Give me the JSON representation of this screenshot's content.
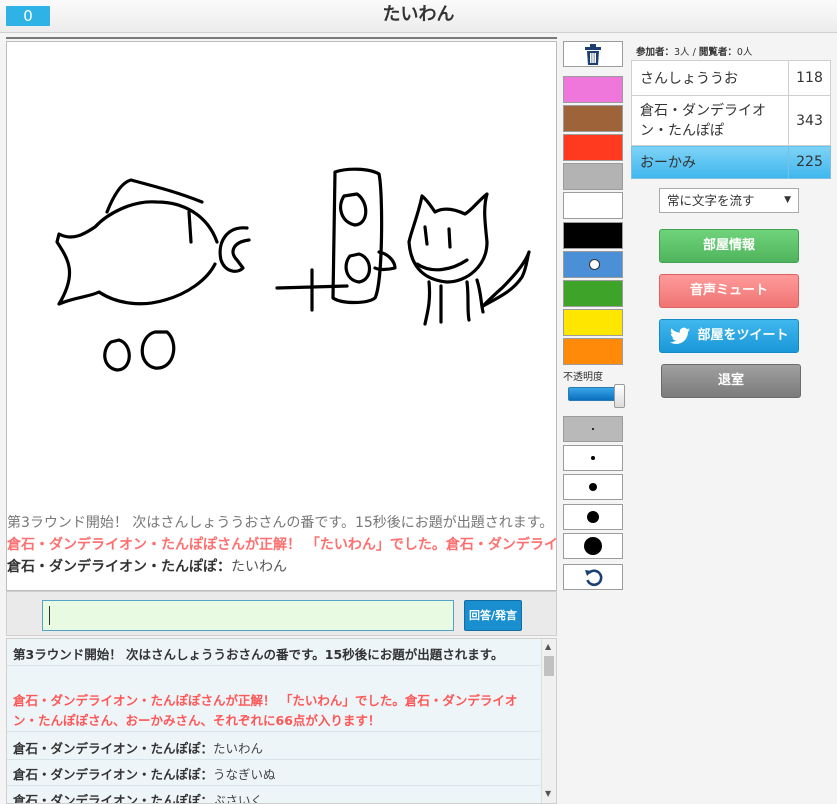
{
  "header": {
    "score": "0",
    "title": "たいわん"
  },
  "canvas_messages": {
    "announce": "第3ラウンド開始！ 次はさんしょううおさんの番です。15秒後にお題が出題されます。",
    "correct": "倉石・ダンデライオン・たんぽぽさんが正解！ 「たいわん」でした。倉石・ダンデライオン・たんぽぽさん",
    "chat_name": "倉石・ダンデライオン・たんぽぽ：",
    "chat_text": "たいわん"
  },
  "input": {
    "value": "",
    "submit_label": "回答/発言"
  },
  "chat_log": [
    {
      "type": "announce",
      "text": "第3ラウンド開始！ 次はさんしょううおさんの番です。15秒後にお題が出題されます。"
    },
    {
      "type": "correct",
      "text": "倉石・ダンデライオン・たんぽぽさんが正解！ 「たいわん」でした。倉石・ダンデライオン・たんぽぽさん、おーかみさん、それぞれに66点が入ります！"
    },
    {
      "type": "msg",
      "name": "倉石・ダンデライオン・たんぽぽ：",
      "text": "たいわん"
    },
    {
      "type": "msg",
      "name": "倉石・ダンデライオン・たんぽぽ：",
      "text": "うなぎいぬ"
    },
    {
      "type": "msg",
      "name": "倉石・ダンデライオン・たんぽぽ：",
      "text": "ぶさいく"
    }
  ],
  "tools": {
    "colors": [
      "#ef76db",
      "#9e6338",
      "#ff3a1f",
      "#b3b3b3",
      "#ffffff",
      "#000000",
      "#4b8fd6",
      "#3ea329",
      "#ffe600",
      "#ff8a0a"
    ],
    "selected_color_index": 6,
    "opacity_label": "不透明度",
    "opacity_value": 1.0,
    "brush_sizes": [
      2,
      4,
      8,
      12,
      18
    ],
    "selected_brush_index": 0
  },
  "sidebar": {
    "participants_label": "参加者：",
    "participants_count": "3人",
    "separator": " / ",
    "viewers_label": "閲覧者：",
    "viewers_count": "0人",
    "players": [
      {
        "name": "さんしょううお",
        "score": "118"
      },
      {
        "name": "倉石・ダンデライオン・たんぽぽ",
        "score": "343"
      },
      {
        "name": "おーかみ",
        "score": "225"
      }
    ],
    "current_player_index": 2,
    "scroll_option": "常に文字を流す",
    "buttons": {
      "room_info": "部屋情報",
      "mute": "音声ミュート",
      "tweet": "部屋をツイート",
      "leave": "退室"
    }
  }
}
